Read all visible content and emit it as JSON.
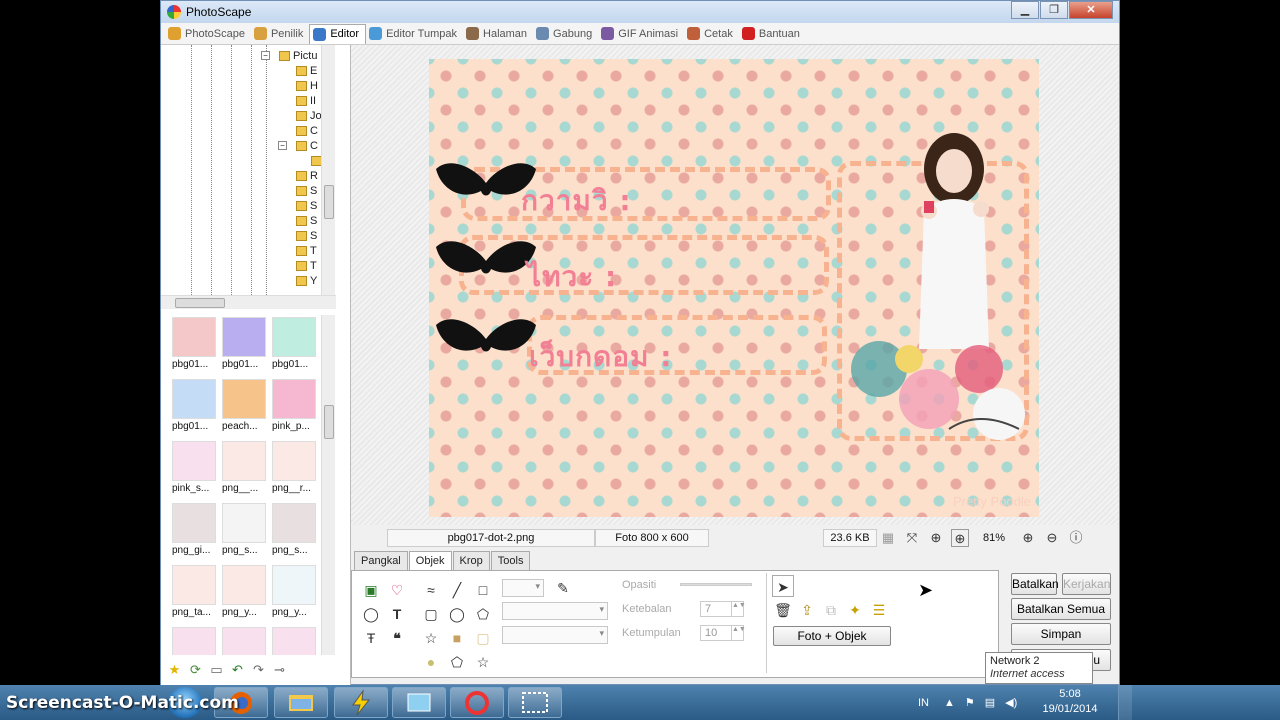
{
  "window": {
    "title": "PhotoScape"
  },
  "window_buttons": {
    "minimize": "▁",
    "maximize": "❐",
    "close": "✕"
  },
  "menu": {
    "tabs": [
      {
        "label": "PhotoScape",
        "color": "#e0a030"
      },
      {
        "label": "Penilik",
        "color": "#d9a040"
      },
      {
        "label": "Editor",
        "color": "#3a78c8"
      },
      {
        "label": "Editor Tumpak",
        "color": "#4a9ad8"
      },
      {
        "label": "Halaman",
        "color": "#8a6a4a"
      },
      {
        "label": "Gabung",
        "color": "#6a8ab0"
      },
      {
        "label": "GIF Animasi",
        "color": "#7a5aa0"
      },
      {
        "label": "Cetak",
        "color": "#c0603a"
      },
      {
        "label": "Bantuan",
        "color": "#d02020"
      }
    ],
    "active_index": 2
  },
  "tree": {
    "items": [
      "Pictu",
      "E",
      "H",
      "II",
      "Jo",
      "C",
      "C",
      "",
      "R",
      "S",
      "S",
      "S",
      "S",
      "T",
      "T",
      "Y"
    ]
  },
  "thumbnails": {
    "items": [
      {
        "label": "pbg01...",
        "color": "#f4c8c8"
      },
      {
        "label": "pbg01...",
        "color": "#b9aef0"
      },
      {
        "label": "pbg01...",
        "color": "#bfeee0"
      },
      {
        "label": "pbg01...",
        "color": "#c4dcf5"
      },
      {
        "label": "peach...",
        "color": "#f6c48a"
      },
      {
        "label": "pink_p...",
        "color": "#f5b8d0"
      },
      {
        "label": "pink_s...",
        "color": "#f9e0ee"
      },
      {
        "label": "png__...",
        "color": "#fbe9e5"
      },
      {
        "label": "png__r...",
        "color": "#fbe9e5"
      },
      {
        "label": "png_gi...",
        "color": "#e8e0e0"
      },
      {
        "label": "png_s...",
        "color": "#f4f4f4"
      },
      {
        "label": "png_s...",
        "color": "#e8e0e0"
      },
      {
        "label": "png_ta...",
        "color": "#fbe9e5"
      },
      {
        "label": "png_y...",
        "color": "#fbe9e5"
      },
      {
        "label": "png_y...",
        "color": "#eef6fa"
      },
      {
        "label": "",
        "color": "#f9e0ee"
      },
      {
        "label": "",
        "color": "#f9e0ee"
      },
      {
        "label": "",
        "color": "#f9e0ee"
      }
    ]
  },
  "card": {
    "lines": [
      "กวามวิ :",
      "ไทวะ :",
      "เว็บกดอม :"
    ],
    "watermark": "Pretty Poodle"
  },
  "status": {
    "filename": "pbg017-dot-2.png",
    "dimensions": "Foto 800 x 600",
    "filesize": "23.6 KB",
    "zoom": "81%"
  },
  "edit_tabs": [
    "Pangkal",
    "Objek",
    "Krop",
    "Tools"
  ],
  "edit_tabs_active": 1,
  "options": {
    "opacity_label": "Opasiti",
    "thickness_label": "Ketebalan",
    "thickness_value": "7",
    "roundness_label": "Ketumpulan",
    "roundness_value": "10",
    "photo_object_button": "Foto + Objek"
  },
  "actions": {
    "undo": "Batalkan",
    "redo": "Kerjakan",
    "undo_all": "Batalkan Semua",
    "save": "Simpan",
    "menu": "nu"
  },
  "tooltip": {
    "title": "Network  2",
    "subtitle": "Internet access"
  },
  "taskbar": {
    "watermark": "Screencast-O-Matic.com",
    "language": "IN",
    "time": "5:08",
    "date": "19/01/2014"
  }
}
